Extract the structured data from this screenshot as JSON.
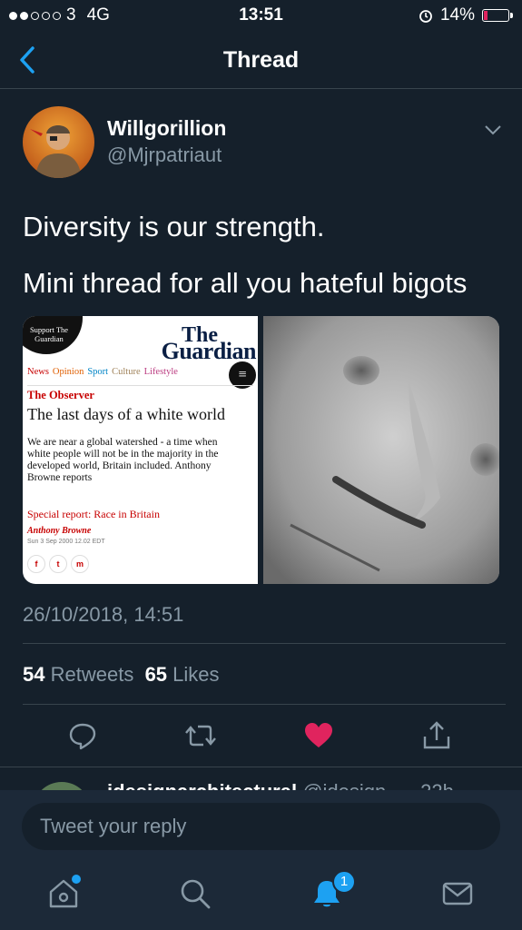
{
  "status_bar": {
    "carrier": "3",
    "network": "4G",
    "time": "13:51",
    "battery": "14%"
  },
  "nav": {
    "title": "Thread"
  },
  "tweet": {
    "display_name": "Willgorillion",
    "handle": "@Mjrpatriaut",
    "text_line1": "Diversity is our strength.",
    "text_line2": "Mini thread for all you hateful bigots",
    "timestamp": "26/10/2018, 14:51",
    "retweets_count": "54",
    "retweets_label": "Retweets",
    "likes_count": "65",
    "likes_label": "Likes",
    "liked": true
  },
  "media_article": {
    "support_label": "Support The Guardian",
    "masthead_the": "The",
    "masthead_name": "Guardian",
    "nav_items": [
      "News",
      "Opinion",
      "Sport",
      "Culture",
      "Lifestyle"
    ],
    "nav_colors": [
      "#c70000",
      "#e05e00",
      "#0084c6",
      "#a1845c",
      "#bb3b80"
    ],
    "section": "The Observer",
    "headline": "The last days of a white world",
    "standfirst": "We are near a global watershed - a time when white people will not be in the majority in the developed world, Britain included. Anthony Browne reports",
    "special_report": "Special report: Race in Britain",
    "author": "Anthony Browne",
    "date": "Sun 3 Sep 2000 12.02 EDT",
    "share_icons": [
      "f",
      "t",
      "m"
    ]
  },
  "next_reply": {
    "name": "idesignarchitectural",
    "handle": "@idesign...",
    "time": "· 22h"
  },
  "reply_box": {
    "placeholder": "Tweet your reply"
  },
  "tab_bar": {
    "notifications_badge": "1"
  },
  "colors": {
    "background": "#15202b",
    "accent": "#1da1f2",
    "like": "#e0245e",
    "secondary_text": "#8899a6"
  }
}
